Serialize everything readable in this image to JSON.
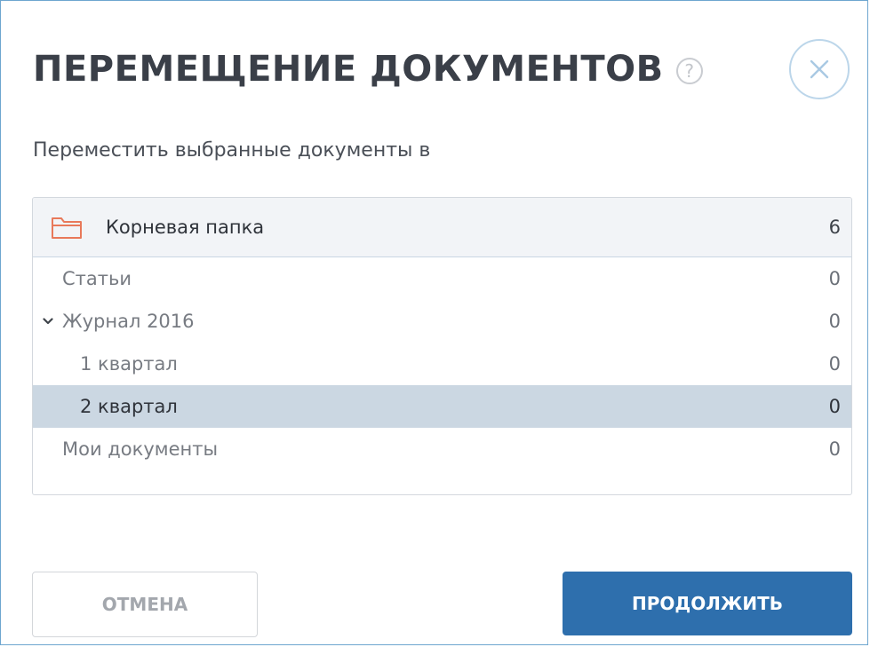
{
  "dialog": {
    "title": "ПЕРЕМЕЩЕНИЕ ДОКУМЕНТОВ",
    "help_icon": "question-circle-icon",
    "help_glyph": "?",
    "close_icon": "close-icon",
    "subtitle": "Переместить выбранные документы в"
  },
  "tree": {
    "root": {
      "icon": "folder-icon",
      "label": "Корневая папка",
      "count": "6"
    },
    "items": [
      {
        "label": "Статьи",
        "count": "0",
        "level": 0,
        "expanded": false,
        "selected": false
      },
      {
        "label": "Журнал 2016",
        "count": "0",
        "level": 0,
        "expanded": true,
        "selected": false
      },
      {
        "label": "1 квартал",
        "count": "0",
        "level": 1,
        "expanded": false,
        "selected": false
      },
      {
        "label": "2 квартал",
        "count": "0",
        "level": 1,
        "expanded": false,
        "selected": true
      },
      {
        "label": "Мои документы",
        "count": "0",
        "level": 0,
        "expanded": false,
        "selected": false
      }
    ]
  },
  "buttons": {
    "cancel_label": "ОТМЕНА",
    "continue_label": "ПРОДОЛЖИТЬ"
  },
  "colors": {
    "accent": "#2e6fad",
    "selected_row": "#cbd7e2",
    "folder": "#e8795a",
    "border": "#6ea6cf"
  }
}
